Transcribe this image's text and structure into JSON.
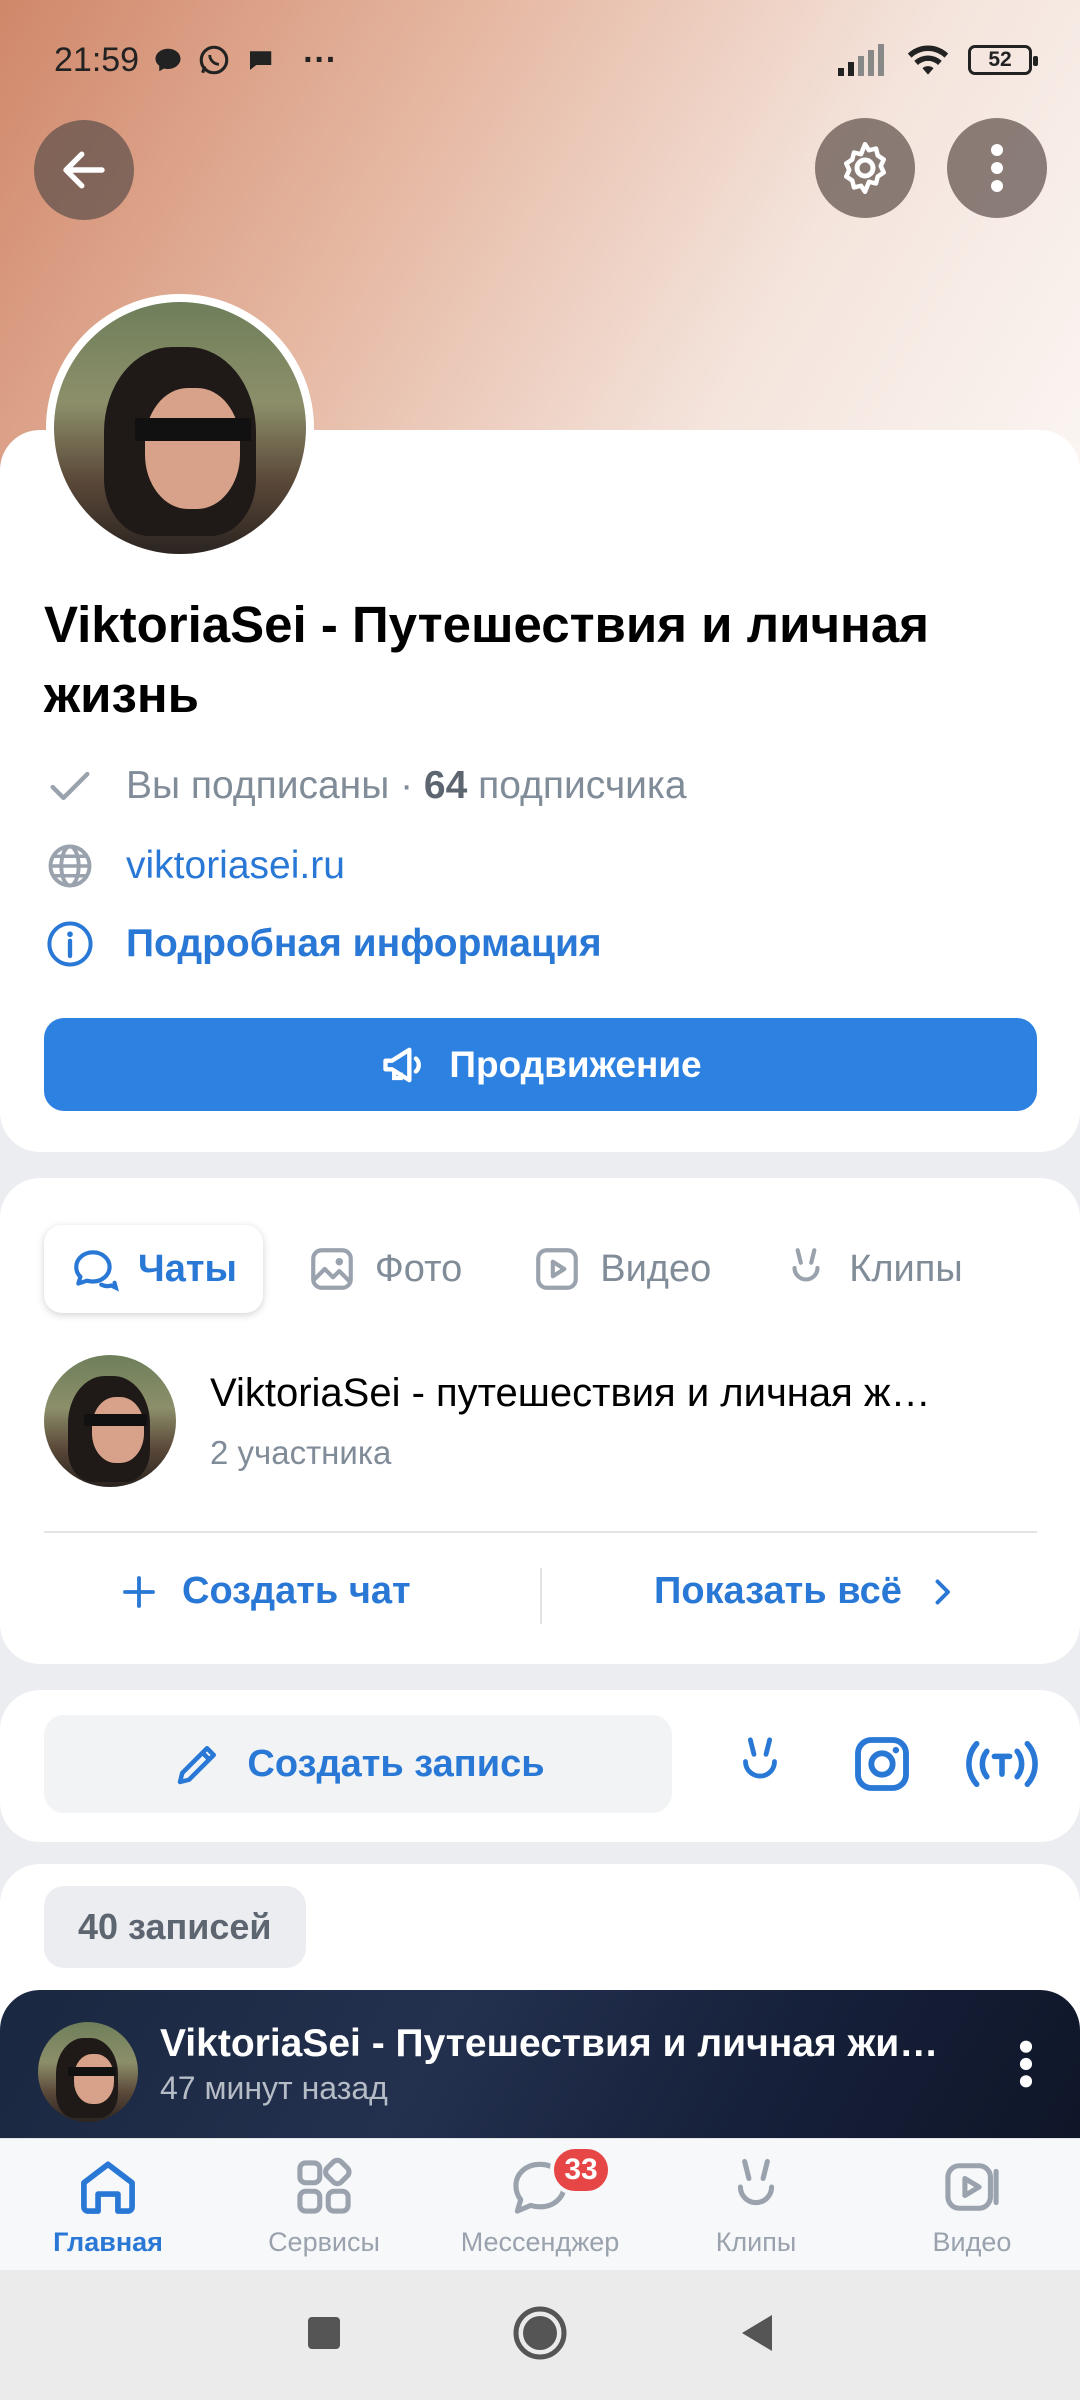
{
  "status_bar": {
    "time": "21:59",
    "dots": "···",
    "battery": "52"
  },
  "profile": {
    "title": "ViktoriaSei - Путешествия и личная жизнь",
    "subscribed_text": "Вы подписаны",
    "separator": " · ",
    "subscribers_count": "64",
    "subscribers_label": "подписчика",
    "website": "viktoriasei.ru",
    "more_info": "Подробная информация",
    "promo_button": "Продвижение"
  },
  "tabs": [
    {
      "label": "Чаты",
      "icon": "chat-icon",
      "active": true
    },
    {
      "label": "Фото",
      "icon": "photo-icon",
      "active": false
    },
    {
      "label": "Видео",
      "icon": "video-icon",
      "active": false
    },
    {
      "label": "Клипы",
      "icon": "clips-icon",
      "active": false
    }
  ],
  "chat": {
    "name": "ViktoriaSei - путешествия и личная ж…",
    "members": "2 участника",
    "create_chat": "Создать чат",
    "show_all": "Показать всё"
  },
  "compose": {
    "create_post": "Создать запись"
  },
  "posts": {
    "count_label": "40 записей",
    "first": {
      "author": "ViktoriaSei - Путешествия и личная жи…",
      "time": "47 минут назад"
    }
  },
  "bottom_nav": [
    {
      "label": "Главная",
      "icon": "home-icon",
      "active": true
    },
    {
      "label": "Сервисы",
      "icon": "services-icon",
      "active": false
    },
    {
      "label": "Мессенджер",
      "icon": "messenger-icon",
      "active": false,
      "badge": "33"
    },
    {
      "label": "Клипы",
      "icon": "clips-icon",
      "active": false
    },
    {
      "label": "Видео",
      "icon": "video-icon",
      "active": false
    }
  ],
  "colors": {
    "accent": "#2d81e0",
    "link": "#2a78d6",
    "badge": "#e64646",
    "muted": "#818c99"
  }
}
